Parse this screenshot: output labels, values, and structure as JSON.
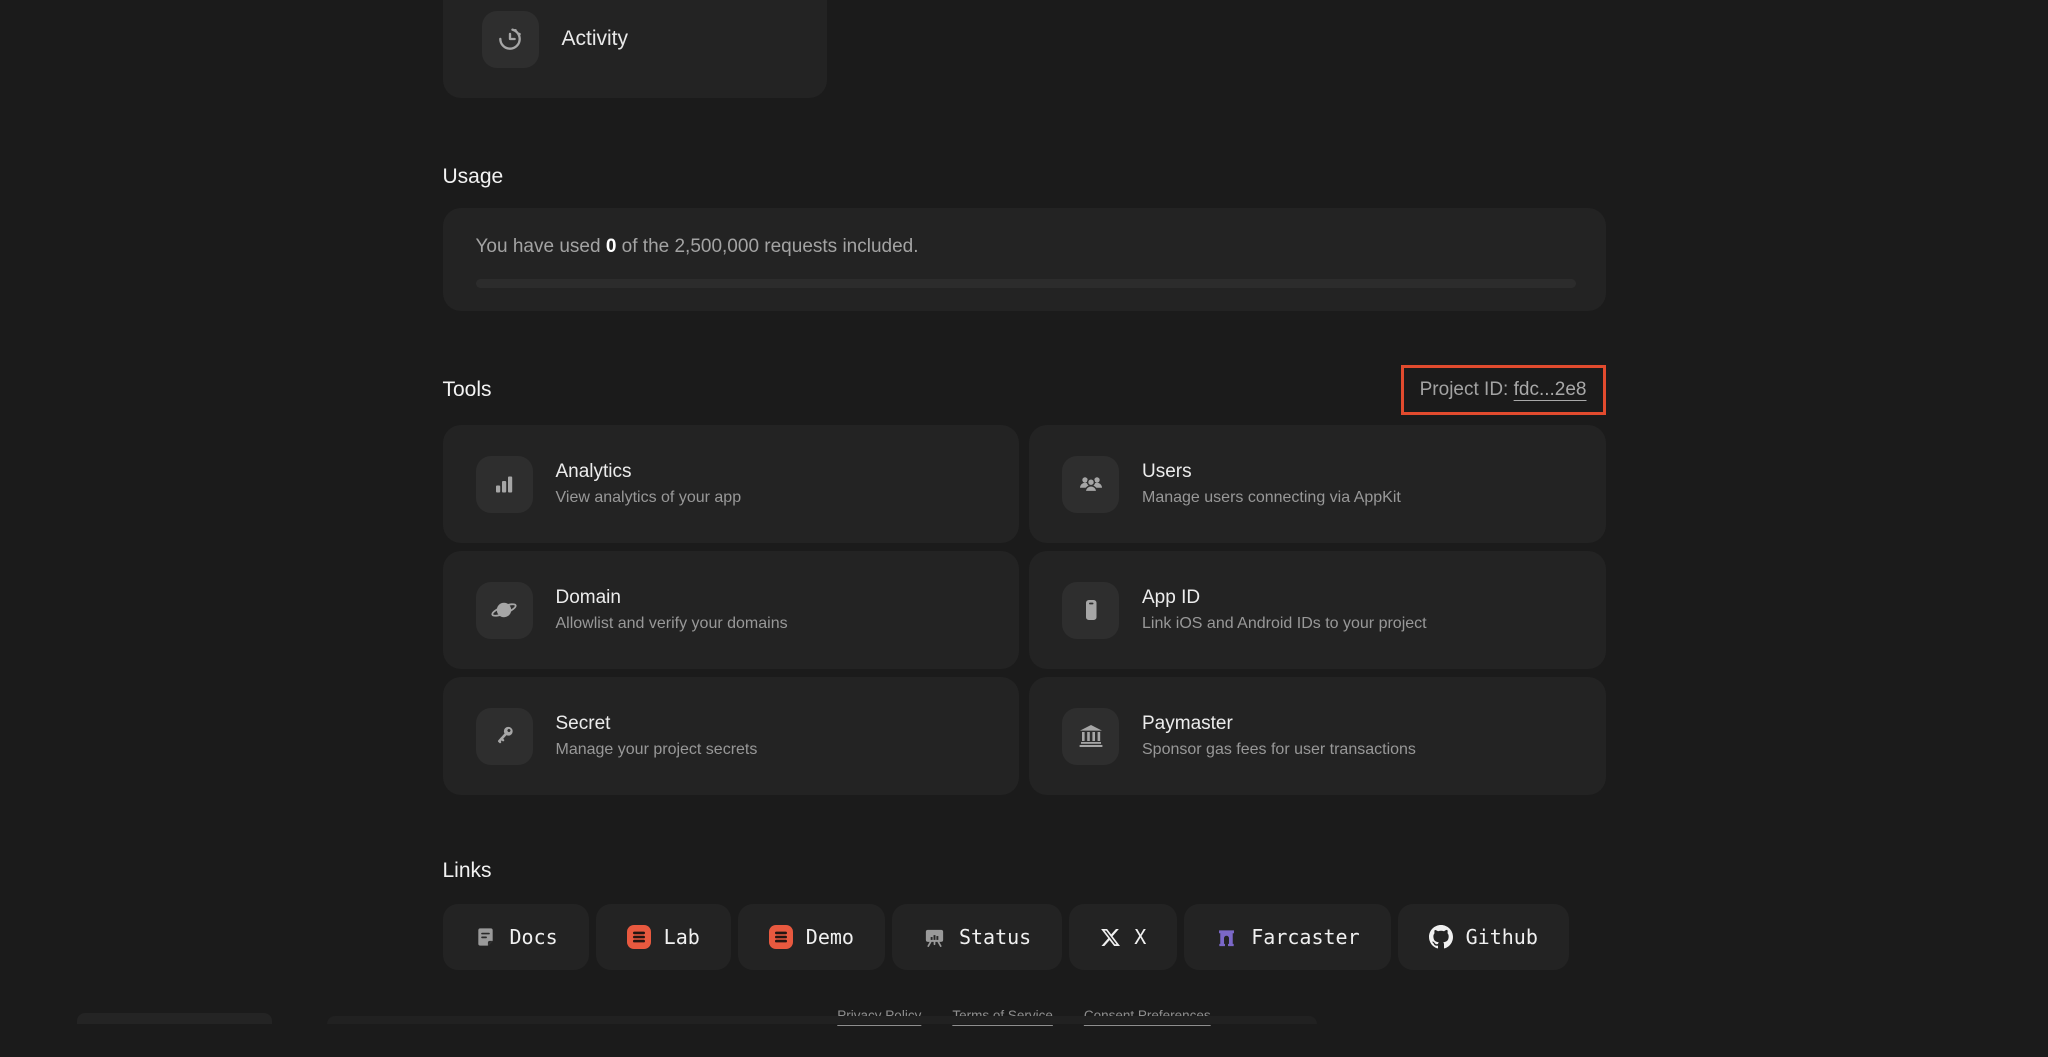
{
  "theme": {
    "background": "#1b1b1b",
    "card_background": "#232323",
    "icon_tile_background": "#2e2e2e",
    "annotation_border": "#e24b2e",
    "lab_icon_color": "#e8593f",
    "farcaster_icon_color": "#7b68c8"
  },
  "activity_card": {
    "label": "Activity",
    "icon": "clock-icon"
  },
  "usage": {
    "heading": "Usage",
    "text_prefix": "You have used ",
    "used_value": "0",
    "text_suffix": " of the 2,500,000 requests included.",
    "progress_percent": 0
  },
  "tools": {
    "heading": "Tools",
    "project_id_label": "Project ID: ",
    "project_id_value": "fdc...2e8",
    "cards": [
      {
        "title": "Analytics",
        "description": "View analytics of your app",
        "icon": "bar-chart-icon"
      },
      {
        "title": "Users",
        "description": "Manage users connecting via AppKit",
        "icon": "users-icon"
      },
      {
        "title": "Domain",
        "description": "Allowlist and verify your domains",
        "icon": "planet-icon"
      },
      {
        "title": "App ID",
        "description": "Link iOS and Android IDs to your project",
        "icon": "phone-icon"
      },
      {
        "title": "Secret",
        "description": "Manage your project secrets",
        "icon": "key-icon"
      },
      {
        "title": "Paymaster",
        "description": "Sponsor gas fees for user transactions",
        "icon": "bank-icon"
      }
    ]
  },
  "links": {
    "heading": "Links",
    "items": [
      {
        "label": "Docs",
        "icon": "docs-icon"
      },
      {
        "label": "Lab",
        "icon": "lab-icon"
      },
      {
        "label": "Demo",
        "icon": "demo-icon"
      },
      {
        "label": "Status",
        "icon": "status-icon"
      },
      {
        "label": "X",
        "icon": "x-logo-icon"
      },
      {
        "label": "Farcaster",
        "icon": "farcaster-icon"
      },
      {
        "label": "Github",
        "icon": "github-icon"
      }
    ]
  },
  "footer": {
    "links": [
      "Privacy Policy",
      "Terms of Service",
      "Consent Preferences"
    ]
  }
}
